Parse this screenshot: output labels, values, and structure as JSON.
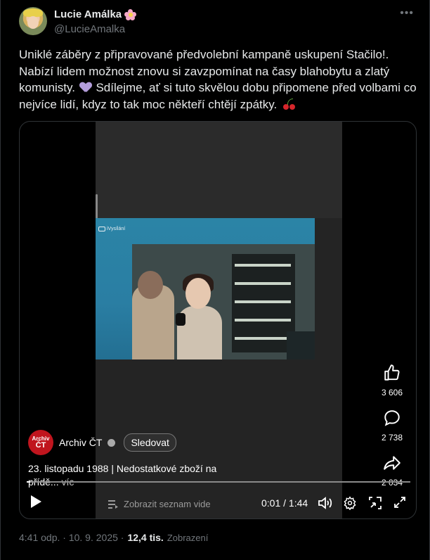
{
  "author": {
    "name": "Lucie Amálka",
    "handle": "@LucieAmalka"
  },
  "post": {
    "text_part1": "Uniklé záběry z připravované předvolební kampaně uskupení Stačilo!. Nabízí lidem možnost znovu si zavzpomínat na časy blahobytu a zlatý komunisty.",
    "text_part2": "Sdílejme, ať si tuto skvělou dobu připomene před volbami co nejvíce lidí, kdyz to tak moc někteří chtějí zpátky."
  },
  "video": {
    "watermark": "iVysílání",
    "likes": "3 606",
    "comments": "2 738",
    "shares": "2 034",
    "channel_avatar_line1": "Archiv",
    "channel_avatar_line2": "ČT",
    "channel_name": "Archiv ČT",
    "follow_label": "Sledovat",
    "description": "23. listopadu 1988 | Nedostatkové zboží na přídě...",
    "description_more": "víc",
    "playlist_label": "Zobrazit seznam vide",
    "time": "0:01 / 1:44",
    "progress": 0.01
  },
  "footer": {
    "timestamp": "4:41 odp. · 10. 9. 2025 ·",
    "views": "12,4 tis.",
    "views_label": "Zobrazení"
  },
  "icons": [
    "more-icon",
    "like-icon",
    "comment-icon",
    "share-icon",
    "play-icon",
    "playlist-icon",
    "volume-icon",
    "settings-icon",
    "pip-icon",
    "fullscreen-icon",
    "heart-emoji-icon",
    "cherry-emoji-icon",
    "flower-emoji-icon"
  ],
  "colors": {
    "background": "#000000",
    "text": "#e7e9ea",
    "muted": "#71767b",
    "channel_red": "#c0151e"
  }
}
